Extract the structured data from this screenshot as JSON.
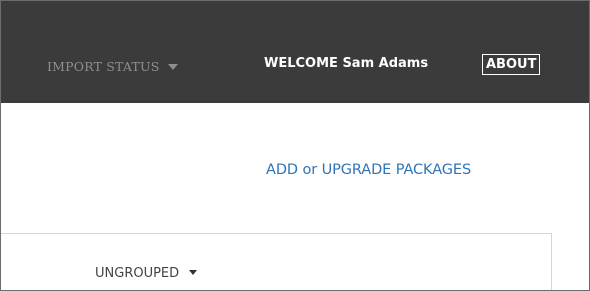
{
  "header": {
    "import_status_label": "IMPORT STATUS",
    "import_status_icon": "caret-down-icon",
    "welcome_text": "WELCOME Sam Adams",
    "about_label": "ABOUT",
    "colors": {
      "background": "#3b3b3b",
      "muted_text": "#8e8e8e",
      "text": "#ffffff"
    }
  },
  "main": {
    "add_upgrade_label": "ADD or UPGRADE PACKAGES",
    "link_color": "#2e75b6"
  },
  "panel": {
    "grouping_label": "UNGROUPED",
    "grouping_icon": "caret-down-icon"
  }
}
